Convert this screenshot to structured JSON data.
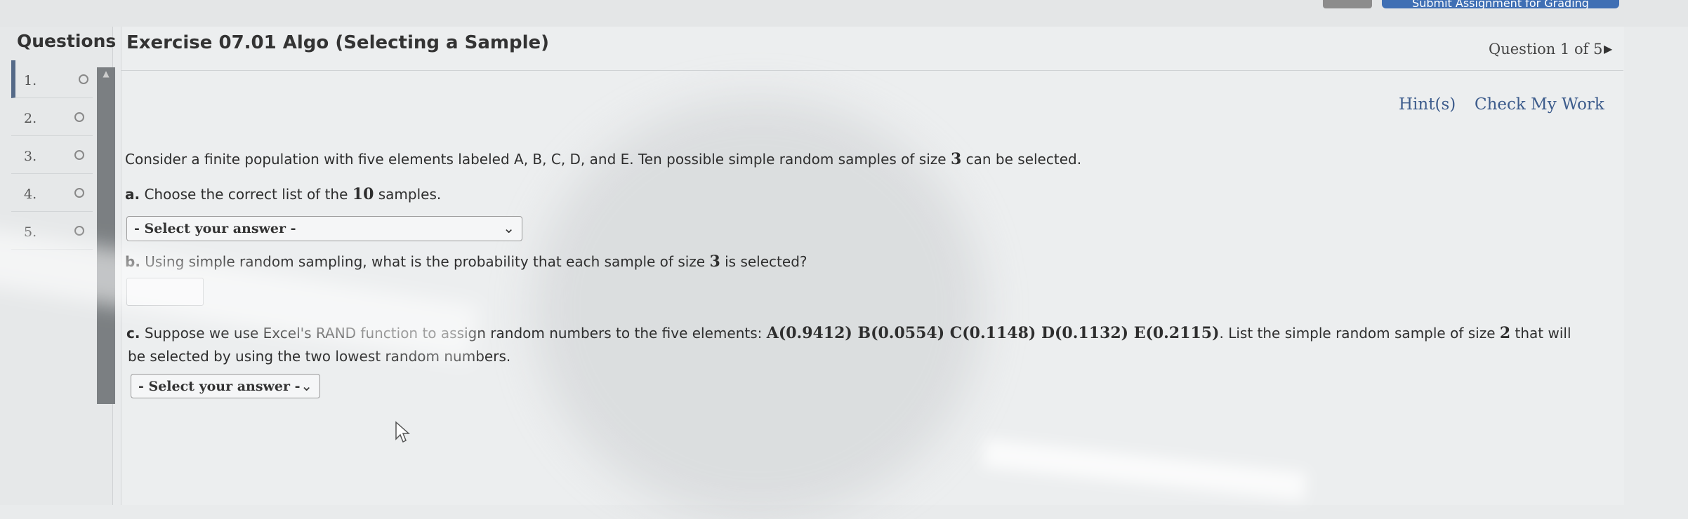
{
  "topbar": {
    "blue_button_label": "Submit Assignment for Grading"
  },
  "sidebar": {
    "title": "Questions",
    "items": [
      {
        "label": "1.",
        "active": true
      },
      {
        "label": "2.",
        "active": false
      },
      {
        "label": "3.",
        "active": false
      },
      {
        "label": "4.",
        "active": false
      },
      {
        "label": "5.",
        "active": false
      }
    ]
  },
  "header": {
    "exercise_title": "Exercise 07.01 Algo (Selecting a Sample)",
    "question_counter": "Question 1 of 5",
    "next_arrow_icon": "caret-right-icon"
  },
  "actions": {
    "hints": "Hint(s)",
    "check_work": "Check My Work"
  },
  "question": {
    "intro_a": "Consider a finite population with five elements labeled A, B, C, D, and E. Ten possible simple random samples of size",
    "intro_n": "3",
    "intro_b": "can be selected.",
    "part_a_prefix": "a.",
    "part_a_text": "Choose the correct list of the",
    "part_a_num": "10",
    "part_a_end": "samples.",
    "select_a": "- Select your answer -",
    "part_b_prefix": "b.",
    "part_b_text": "Using simple random sampling, what is the probability that each sample of size",
    "part_b_num": "3",
    "part_b_end": "is selected?",
    "part_c_prefix": "c.",
    "part_c_text": "Suppose we use Excel's RAND function to assign random numbers to the five elements:",
    "part_c_math": "A(0.9412) B(0.0554) C(0.1148) D(0.1132) E(0.2115)",
    "part_c_text2": ". List the simple random sample of size",
    "part_c_num": "2",
    "part_c_end": "that will",
    "part_c_line2": "be selected by using the two lowest random numbers.",
    "select_c": "- Select your answer -"
  },
  "colors": {
    "link": "#3d5c8c",
    "active_marker": "#556a88",
    "primary_button": "#3f6fb4"
  }
}
